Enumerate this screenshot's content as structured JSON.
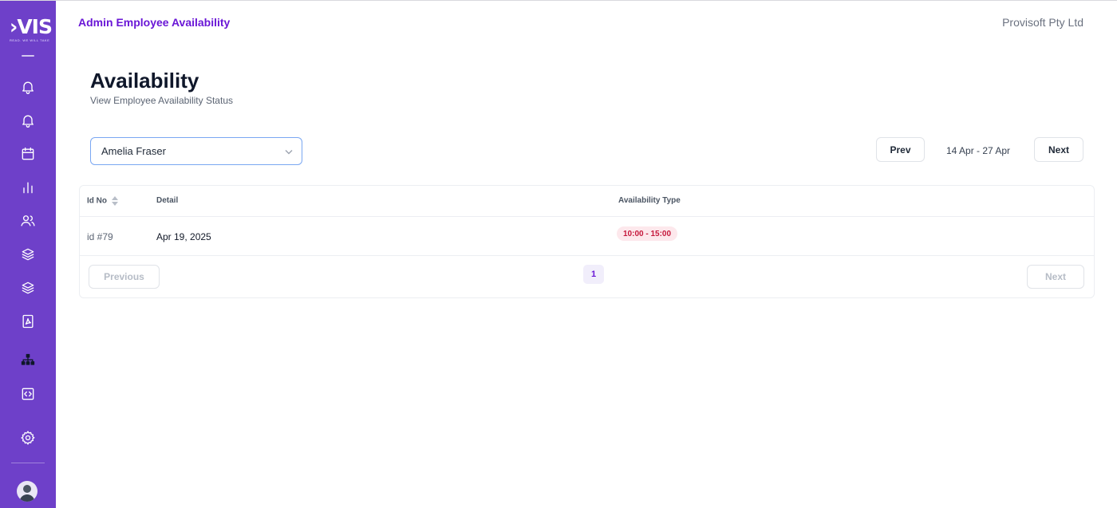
{
  "sidebar": {
    "logo_text": "VIS",
    "logo_tagline": "READ. WE WILL TAKE",
    "icons": [
      "bell-icon",
      "bell-icon",
      "calendar-icon",
      "bar-chart-icon",
      "users-icon",
      "layers-icon",
      "layers-icon",
      "pdf-file-icon",
      "hierarchy-icon",
      "code-icon",
      "gear-icon"
    ]
  },
  "header": {
    "title": "Admin Employee Availability",
    "company": "Provisoft Pty Ltd"
  },
  "page": {
    "title": "Availability",
    "subtitle": "View Employee Availability Status"
  },
  "filters": {
    "employee_selected": "Amelia Fraser",
    "prev_label": "Prev",
    "next_label": "Next",
    "date_range": "14 Apr - 27 Apr"
  },
  "table": {
    "columns": [
      "Id No",
      "Detail",
      "Availability Type"
    ],
    "rows": [
      {
        "id": "id #79",
        "detail": "Apr 19, 2025",
        "availability": "10:00 - 15:00"
      }
    ]
  },
  "pagination": {
    "previous_label": "Previous",
    "next_label": "Next",
    "current_page": "1"
  },
  "colors": {
    "sidebar": "#6e40c9",
    "accent": "#6a17d6",
    "badge_bg": "#fde8ec",
    "badge_text": "#c5173b"
  }
}
